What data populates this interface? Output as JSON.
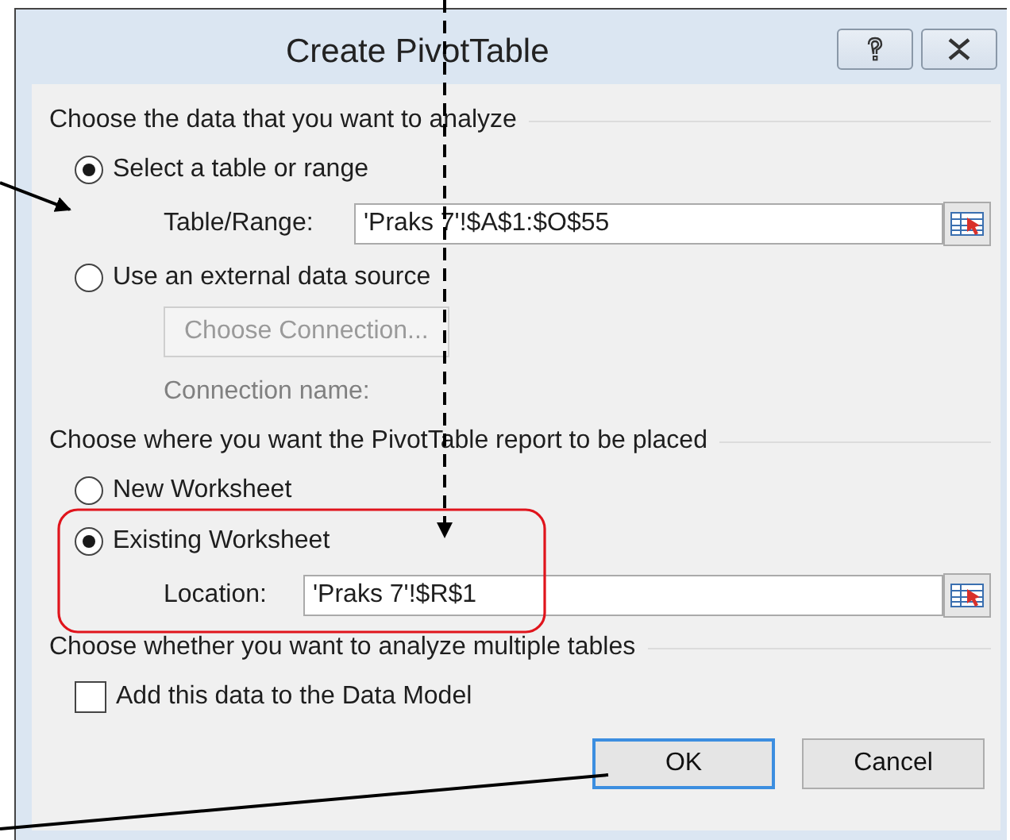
{
  "window": {
    "title": "Create PivotTable"
  },
  "sections": [
    {
      "heading": "Choose the data that you want to analyze",
      "items": [
        {
          "kind": "radio",
          "label": "Select a table or range",
          "selected": true
        },
        {
          "kind": "field",
          "label": "Table/Range:",
          "value": "'Praks 7'!$A$1:$O$55"
        },
        {
          "kind": "radio",
          "label": "Use an external data source",
          "selected": false
        },
        {
          "kind": "button",
          "label": "Choose Connection...",
          "disabled": true
        },
        {
          "kind": "text",
          "label": "Connection name:",
          "disabled": true
        }
      ]
    },
    {
      "heading": "Choose where you want the PivotTable report to be placed",
      "items": [
        {
          "kind": "radio",
          "label": "New Worksheet",
          "selected": false
        },
        {
          "kind": "radio",
          "label": "Existing Worksheet",
          "selected": true
        },
        {
          "kind": "field",
          "label": "Location:",
          "value": "'Praks 7'!$R$1"
        }
      ]
    },
    {
      "heading": "Choose whether you want to analyze multiple tables",
      "items": [
        {
          "kind": "checkbox",
          "label": "Add this data to the Data Model",
          "checked": false
        }
      ]
    }
  ],
  "buttons": [
    {
      "label": "OK",
      "default": true
    },
    {
      "label": "Cancel",
      "default": false
    }
  ]
}
